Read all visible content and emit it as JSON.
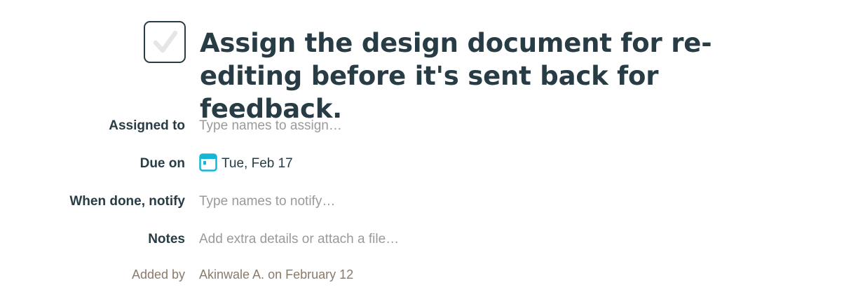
{
  "task": {
    "title": "Assign the design document for re-editing before it's sent back for feedback.",
    "completed": false
  },
  "fields": {
    "assigned_to": {
      "label": "Assigned to",
      "placeholder": "Type names to assign…"
    },
    "due_on": {
      "label": "Due on",
      "value": "Tue, Feb 17",
      "icon": "calendar-icon"
    },
    "notify": {
      "label": "When done, notify",
      "placeholder": "Type names to notify…"
    },
    "notes": {
      "label": "Notes",
      "placeholder": "Add extra details or attach a file…"
    },
    "added_by": {
      "label": "Added by",
      "author": "Akinwale A.",
      "connector": "on",
      "date": "February 12"
    }
  },
  "colors": {
    "text": "#283c46",
    "placeholder": "#9a9a9a",
    "muted": "#8a7a6a",
    "calendar_accent": "#15b5d6",
    "check_mark": "#e6e6e6"
  }
}
